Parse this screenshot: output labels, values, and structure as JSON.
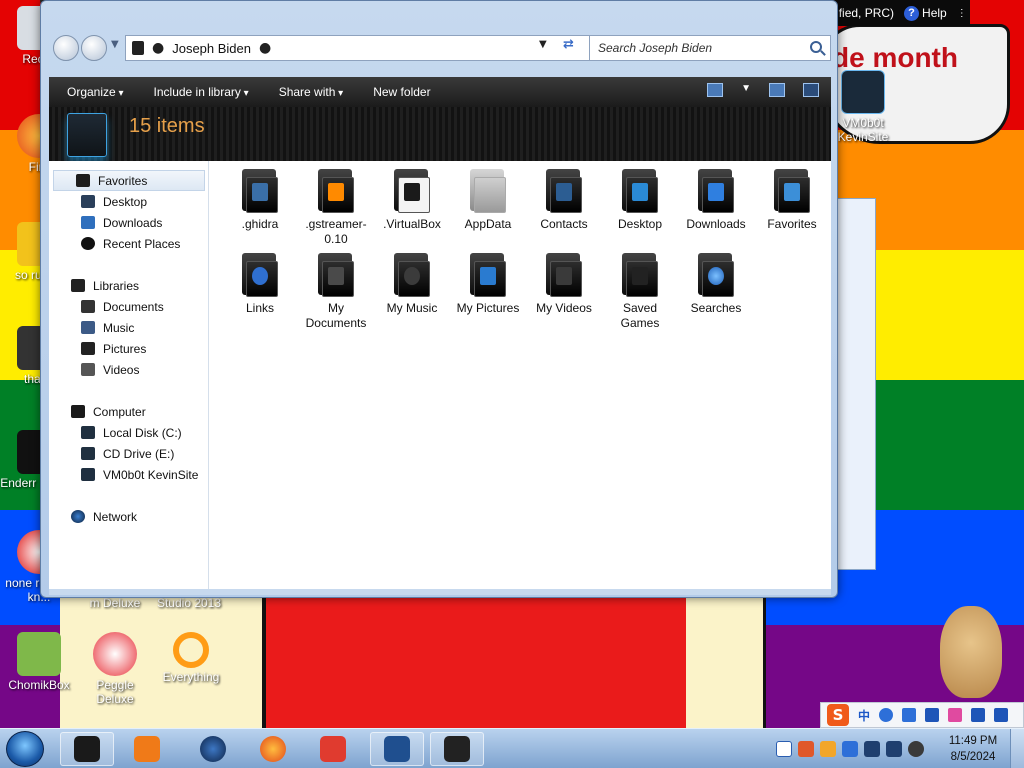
{
  "window": {
    "breadcrumb": "Joseph Biden",
    "search_placeholder": "Search Joseph Biden",
    "item_count": "15 items",
    "toolbar": {
      "organize": "Organize",
      "include_in_library": "Include in library",
      "share_with": "Share with",
      "new_folder": "New folder"
    },
    "nav": {
      "favorites": "Favorites",
      "favorites_items": [
        "Desktop",
        "Downloads",
        "Recent Places"
      ],
      "libraries": "Libraries",
      "libraries_items": [
        "Documents",
        "Music",
        "Pictures",
        "Videos"
      ],
      "computer": "Computer",
      "computer_items": [
        "Local Disk (C:)",
        "CD Drive (E:)",
        "VM0b0t KevinSite"
      ],
      "network": "Network"
    },
    "items": [
      {
        "name": ".ghidra",
        "icon": "ghidra-folder-icon"
      },
      {
        "name": ".gstreamer-0.10",
        "icon": "vlc-folder-icon"
      },
      {
        "name": ".VirtualBox",
        "icon": "document-folder-icon"
      },
      {
        "name": "AppData",
        "icon": "gray-folder-icon"
      },
      {
        "name": "Contacts",
        "icon": "contacts-folder-icon"
      },
      {
        "name": "Desktop",
        "icon": "desktop-folder-icon"
      },
      {
        "name": "Downloads",
        "icon": "downloads-folder-icon"
      },
      {
        "name": "Favorites",
        "icon": "favorites-folder-icon"
      },
      {
        "name": "Links",
        "icon": "links-folder-icon"
      },
      {
        "name": "My Documents",
        "icon": "documents-folder-icon"
      },
      {
        "name": "My Music",
        "icon": "music-folder-icon"
      },
      {
        "name": "My Pictures",
        "icon": "pictures-folder-icon"
      },
      {
        "name": "My Videos",
        "icon": "videos-folder-icon"
      },
      {
        "name": "Saved Games",
        "icon": "saved-games-folder-icon"
      },
      {
        "name": "Searches",
        "icon": "searches-folder-icon"
      }
    ]
  },
  "language_bar": {
    "language": "CH Chinese (Simplified, PRC)",
    "help": "Help"
  },
  "desktop": {
    "wallpaper_text": "de month",
    "icons": [
      {
        "label": "Recyc",
        "icon": "recycle-bin-icon"
      },
      {
        "label": "Fire",
        "icon": "firefox-icon"
      },
      {
        "label": "so russia",
        "icon": "app-icon"
      },
      {
        "label": "that b",
        "icon": "folder-icon"
      },
      {
        "label": "Enderr @NOB",
        "icon": "app-icon"
      },
      {
        "label": "none retards kn...",
        "icon": "app-icon"
      },
      {
        "label": "m Deluxe",
        "icon": "app-icon"
      },
      {
        "label": "Studio 2013",
        "icon": "app-icon"
      },
      {
        "label": "ChomikBox",
        "icon": "chomikbox-icon"
      },
      {
        "label": "Peggle Deluxe",
        "icon": "peggle-icon"
      },
      {
        "label": "Everything",
        "icon": "everything-search-icon"
      },
      {
        "label": "VM0b0t KevinSite",
        "icon": "vm-icon"
      }
    ]
  },
  "taskbar": {
    "time": "11:49 PM",
    "date": "8/5/2024",
    "ime_label": "中"
  },
  "colors": {
    "accent_count": "#e6a04a",
    "toolbar_bg": "#1b1b1b",
    "window_chrome": "#c6d9ef"
  }
}
